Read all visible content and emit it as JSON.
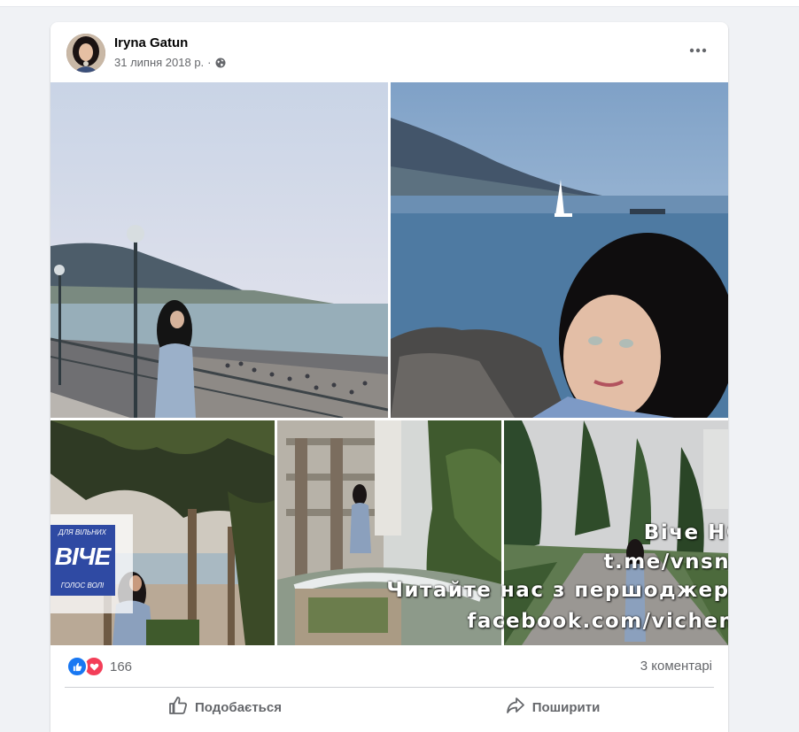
{
  "post": {
    "author": "Iryna Gatun",
    "date": "31 липня 2018 р.",
    "separator": "·",
    "privacy_icon": "globe-icon",
    "more_icon": "more-horizontal-icon"
  },
  "watermark": {
    "logo_top": "ДЛЯ ВІЛЬНИХ",
    "logo_main": "ВІЧЕ",
    "logo_bottom": "ГОЛОС ВОЛІ",
    "line1": "Віче НСН",
    "line2": "t.me/vnsnua",
    "line3": "Читайте нас з першоджерел",
    "line4": "facebook.com/vichenet"
  },
  "reactions": {
    "types": [
      "like-reaction-icon",
      "love-reaction-icon"
    ],
    "count": "166",
    "comments": "3 коментарі"
  },
  "actions": {
    "like_label": "Подобається",
    "share_label": "Поширити"
  },
  "colors": {
    "like_blue": "#1877f2",
    "love_red": "#f33e58",
    "secondary_text": "#65676b",
    "watermark_blue": "#2f4aa3"
  }
}
